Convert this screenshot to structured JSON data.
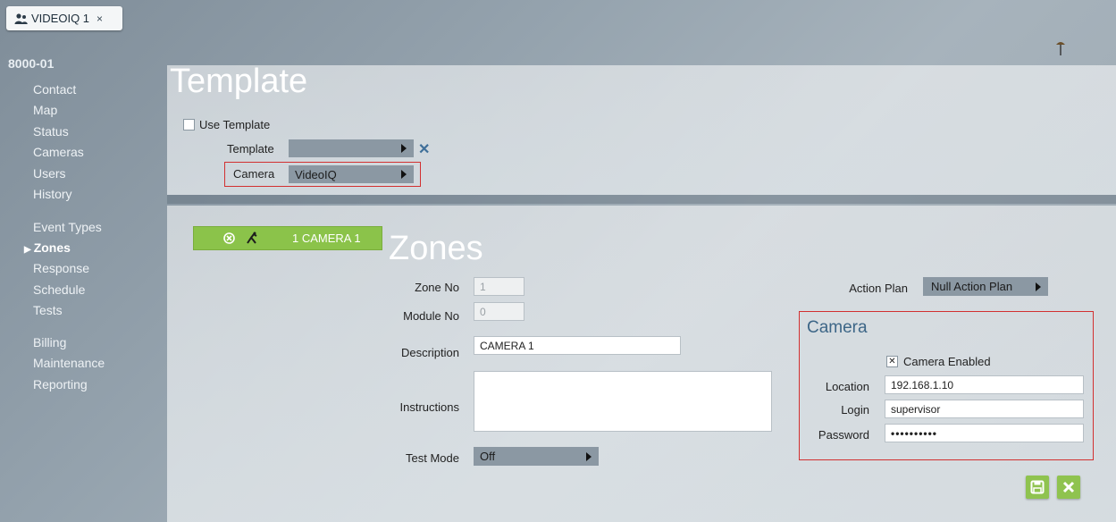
{
  "tab": {
    "label": "VIDEOIQ 1",
    "close": "×"
  },
  "sidebar": {
    "account": "8000-01",
    "items": [
      {
        "label": "Contact"
      },
      {
        "label": "Map"
      },
      {
        "label": "Status"
      },
      {
        "label": "Cameras"
      },
      {
        "label": "Users"
      },
      {
        "label": "History"
      },
      {
        "label": "Event Types"
      },
      {
        "label": "Zones",
        "active": true
      },
      {
        "label": "Response"
      },
      {
        "label": "Schedule"
      },
      {
        "label": "Tests"
      },
      {
        "label": "Billing"
      },
      {
        "label": "Maintenance"
      },
      {
        "label": "Reporting"
      }
    ]
  },
  "template_section": {
    "title": "Template",
    "use_template_label": "Use Template",
    "use_template_checked": false,
    "template_label": "Template",
    "template_value": "",
    "clear_symbol": "✕",
    "camera_label": "Camera",
    "camera_value": "VideoIQ"
  },
  "zones_section": {
    "title": "Zones",
    "zone_list": [
      {
        "label": "1 CAMERA 1"
      }
    ],
    "zone_no_label": "Zone No",
    "zone_no_value": "1",
    "module_no_label": "Module No",
    "module_no_value": "0",
    "description_label": "Description",
    "description_value": "CAMERA 1",
    "instructions_label": "Instructions",
    "instructions_value": "",
    "test_mode_label": "Test Mode",
    "test_mode_value": "Off",
    "action_plan_label": "Action Plan",
    "action_plan_value": "Null Action Plan"
  },
  "camera_panel": {
    "heading": "Camera",
    "enabled_label": "Camera Enabled",
    "enabled_checked": true,
    "location_label": "Location",
    "location_value": "192.168.1.10",
    "login_label": "Login",
    "login_value": "supervisor",
    "password_label": "Password",
    "password_value": "••••••••••"
  },
  "colors": {
    "accent_green": "#8bc34a",
    "highlight_red": "#d23030",
    "heading_blue": "#3d6687"
  }
}
